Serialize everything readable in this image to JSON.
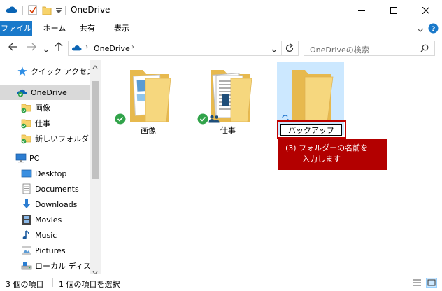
{
  "window": {
    "title": "OneDrive"
  },
  "ribbon": {
    "tabs": [
      "ファイル",
      "ホーム",
      "共有",
      "表示"
    ]
  },
  "address": {
    "path": [
      "OneDrive"
    ],
    "search_placeholder": "OneDriveの検索"
  },
  "sidebar": {
    "quick_access": "クイック アクセス",
    "onedrive": "OneDrive",
    "onedrive_children": [
      "画像",
      "仕事",
      "新しいフォルダー"
    ],
    "pc": "PC",
    "pc_children": [
      "Desktop",
      "Documents",
      "Downloads",
      "Movies",
      "Music",
      "Pictures",
      "ローカル ディスク (C"
    ]
  },
  "folders": [
    {
      "name": "画像"
    },
    {
      "name": "仕事"
    }
  ],
  "rename": {
    "value": "バックアップ"
  },
  "callout": {
    "line1": "(3) フォルダーの名前を",
    "line2": "入力します"
  },
  "status": {
    "count": "3 個の項目",
    "selected": "1 個の項目を選択"
  },
  "colors": {
    "accent": "#1979ca",
    "callout": "#b30000",
    "selection": "#cce8ff"
  }
}
